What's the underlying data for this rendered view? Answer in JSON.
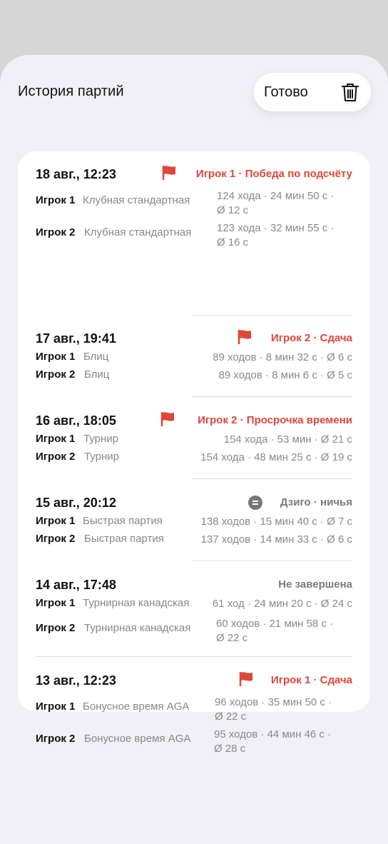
{
  "header": {
    "title": "История партий",
    "done_label": "Готово",
    "trash_icon": "trash-icon"
  },
  "colors": {
    "accent_red": "#e0463a",
    "muted_gray": "#7a7a7a"
  },
  "games": [
    {
      "date": "18 авг., 12:23",
      "result_icon": "flag-icon",
      "result": "Игрок 1 · Победа по подсчёту",
      "players": [
        {
          "name": "Игрок 1",
          "control": "Клубная стандартная",
          "stats_line1": "124 хода · 24 мин 50 с ·",
          "stats_line2": "Ø 12 с"
        },
        {
          "name": "Игрок 2",
          "control": "Клубная стандартная",
          "stats_line1": "123 хода · 32 мин 55 с ·",
          "stats_line2": "Ø 16 с"
        }
      ]
    },
    {
      "date": "17 авг., 19:41",
      "result_icon": "flag-icon",
      "result": "Игрок 2 · Сдача",
      "players": [
        {
          "name": "Игрок 1",
          "control": "Блиц",
          "stats": "89 ходов · 8 мин 32 с · Ø 6 с"
        },
        {
          "name": "Игрок 2",
          "control": "Блиц",
          "stats": "89 ходов · 8 мин 6 с · Ø 5 с"
        }
      ]
    },
    {
      "date": "16 авг., 18:05",
      "result_icon": "flag-icon",
      "result": "Игрок 2 · Просрочка времени",
      "players": [
        {
          "name": "Игрок 1",
          "control": "Турнир",
          "stats": "154 хода · 53 мин · Ø 21 с"
        },
        {
          "name": "Игрок 2",
          "control": "Турнир",
          "stats": "154 хода · 48 мин 25 с · Ø 19 с"
        }
      ]
    },
    {
      "date": "15 авг., 20:12",
      "result_icon": "equals-icon",
      "result": "Дзиго · ничья",
      "players": [
        {
          "name": "Игрок 1",
          "control": "Быстрая партия",
          "stats": "138 ходов · 15 мин 40 с · Ø 7 с"
        },
        {
          "name": "Игрок 2",
          "control": "Быстрая партия",
          "stats": "137 ходов · 14 мин 33 с · Ø 6 с"
        }
      ]
    },
    {
      "date": "14 авг., 17:48",
      "result": "Не завершена",
      "players": [
        {
          "name": "Игрок 1",
          "control": "Турнирная канадская",
          "stats": "61 ход · 24 мин 20 с · Ø 24 с"
        },
        {
          "name": "Игрок 2",
          "control": "Турнирная канадская",
          "stats_line1": "60 ходов · 21 мин 58 с ·",
          "stats_line2": "Ø 22 с"
        }
      ]
    },
    {
      "date": "13 авг., 12:23",
      "result_icon": "flag-icon",
      "result": "Игрок 1 · Сдача",
      "players": [
        {
          "name": "Игрок 1",
          "control": "Бонусное время AGA",
          "stats_line1": "96 ходов · 35 мин 50 с ·",
          "stats_line2": "Ø 22 с"
        },
        {
          "name": "Игрок 2",
          "control": "Бонусное время AGA",
          "stats_line1": "95 ходов · 44 мин 46 с ·",
          "stats_line2": "Ø 28 с"
        }
      ]
    }
  ]
}
